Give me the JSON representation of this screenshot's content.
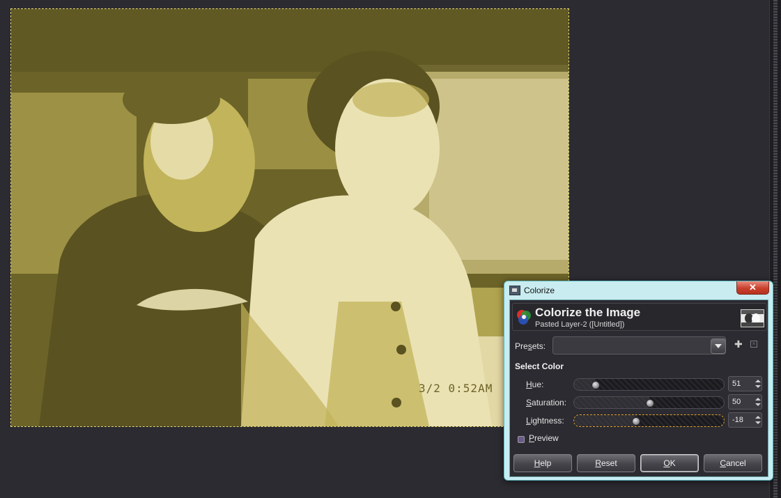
{
  "dialog": {
    "window_title": "Colorize",
    "close_glyph": "✕",
    "header_title": "Colorize the Image",
    "header_subtitle": "Pasted Layer-2 ([Untitled])",
    "presets_label_pre": "Pre",
    "presets_label_u": "s",
    "presets_label_post": "ets:",
    "presets_value": "",
    "section_title": "Select Color",
    "hue": {
      "label_u": "H",
      "label_rest": "ue:",
      "value": "51",
      "position": 0.1417
    },
    "saturation": {
      "label_u": "S",
      "label_rest": "aturation:",
      "value": "50",
      "position": 0.5
    },
    "lightness": {
      "label_u": "L",
      "label_rest": "ightness:",
      "value": "-18",
      "position": 0.41
    },
    "preview_label_u": "P",
    "preview_label_rest": "review",
    "preview_checked": true,
    "buttons": {
      "help_u": "H",
      "help_rest": "elp",
      "reset_u": "R",
      "reset_rest": "eset",
      "ok_u": "O",
      "ok_rest": "K",
      "cancel_u": "C",
      "cancel_rest": "ancel"
    }
  },
  "image": {
    "timestamp_overlay": "3/2  0:52AM",
    "palette": {
      "dark": "#6b6328",
      "mid": "#c2b45a",
      "light": "#ebe2b4"
    }
  }
}
